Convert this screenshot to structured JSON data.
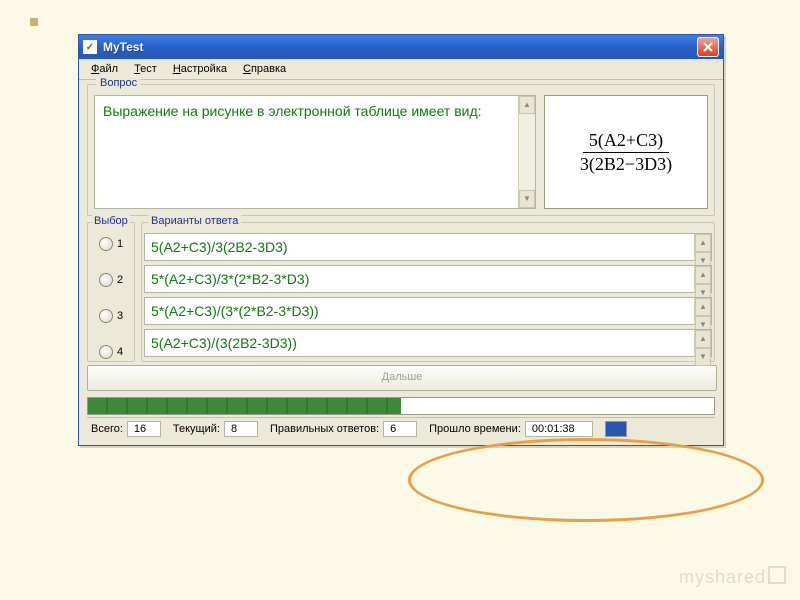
{
  "window": {
    "title": "MyTest",
    "app_icon_glyph": "✓"
  },
  "menu": {
    "items": [
      {
        "html": "<u>Ф</u>айл"
      },
      {
        "html": "<u>Т</u>ест"
      },
      {
        "html": "<u>Н</u>астройка"
      },
      {
        "html": "<u>С</u>правка"
      }
    ]
  },
  "question": {
    "legend": "Вопрос",
    "text": "Выражение на рисунке в электронной таблице имеет вид:",
    "formula": {
      "numerator": "5(A2+C3)",
      "denominator": "3(2B2−3D3)"
    }
  },
  "choice": {
    "legend": "Выбор",
    "numbers": [
      "1",
      "2",
      "3",
      "4"
    ]
  },
  "answers": {
    "legend": "Варианты ответа",
    "items": [
      "5(A2+C3)/3(2B2-3D3)",
      "5*(A2+C3)/3*(2*B2-3*D3)",
      "5*(A2+C3)/(3*(2*B2-3*D3))",
      "5(A2+C3)/(3(2B2-3D3))"
    ]
  },
  "next_button": "Дальше",
  "progress_percent": 50,
  "status": {
    "total_label": "Всего:",
    "total_value": "16",
    "current_label": "Текущий:",
    "current_value": "8",
    "correct_label": "Правильных ответов:",
    "correct_value": "6",
    "elapsed_label": "Прошло времени:",
    "elapsed_value": "00:01:38"
  },
  "watermark": "myshared"
}
